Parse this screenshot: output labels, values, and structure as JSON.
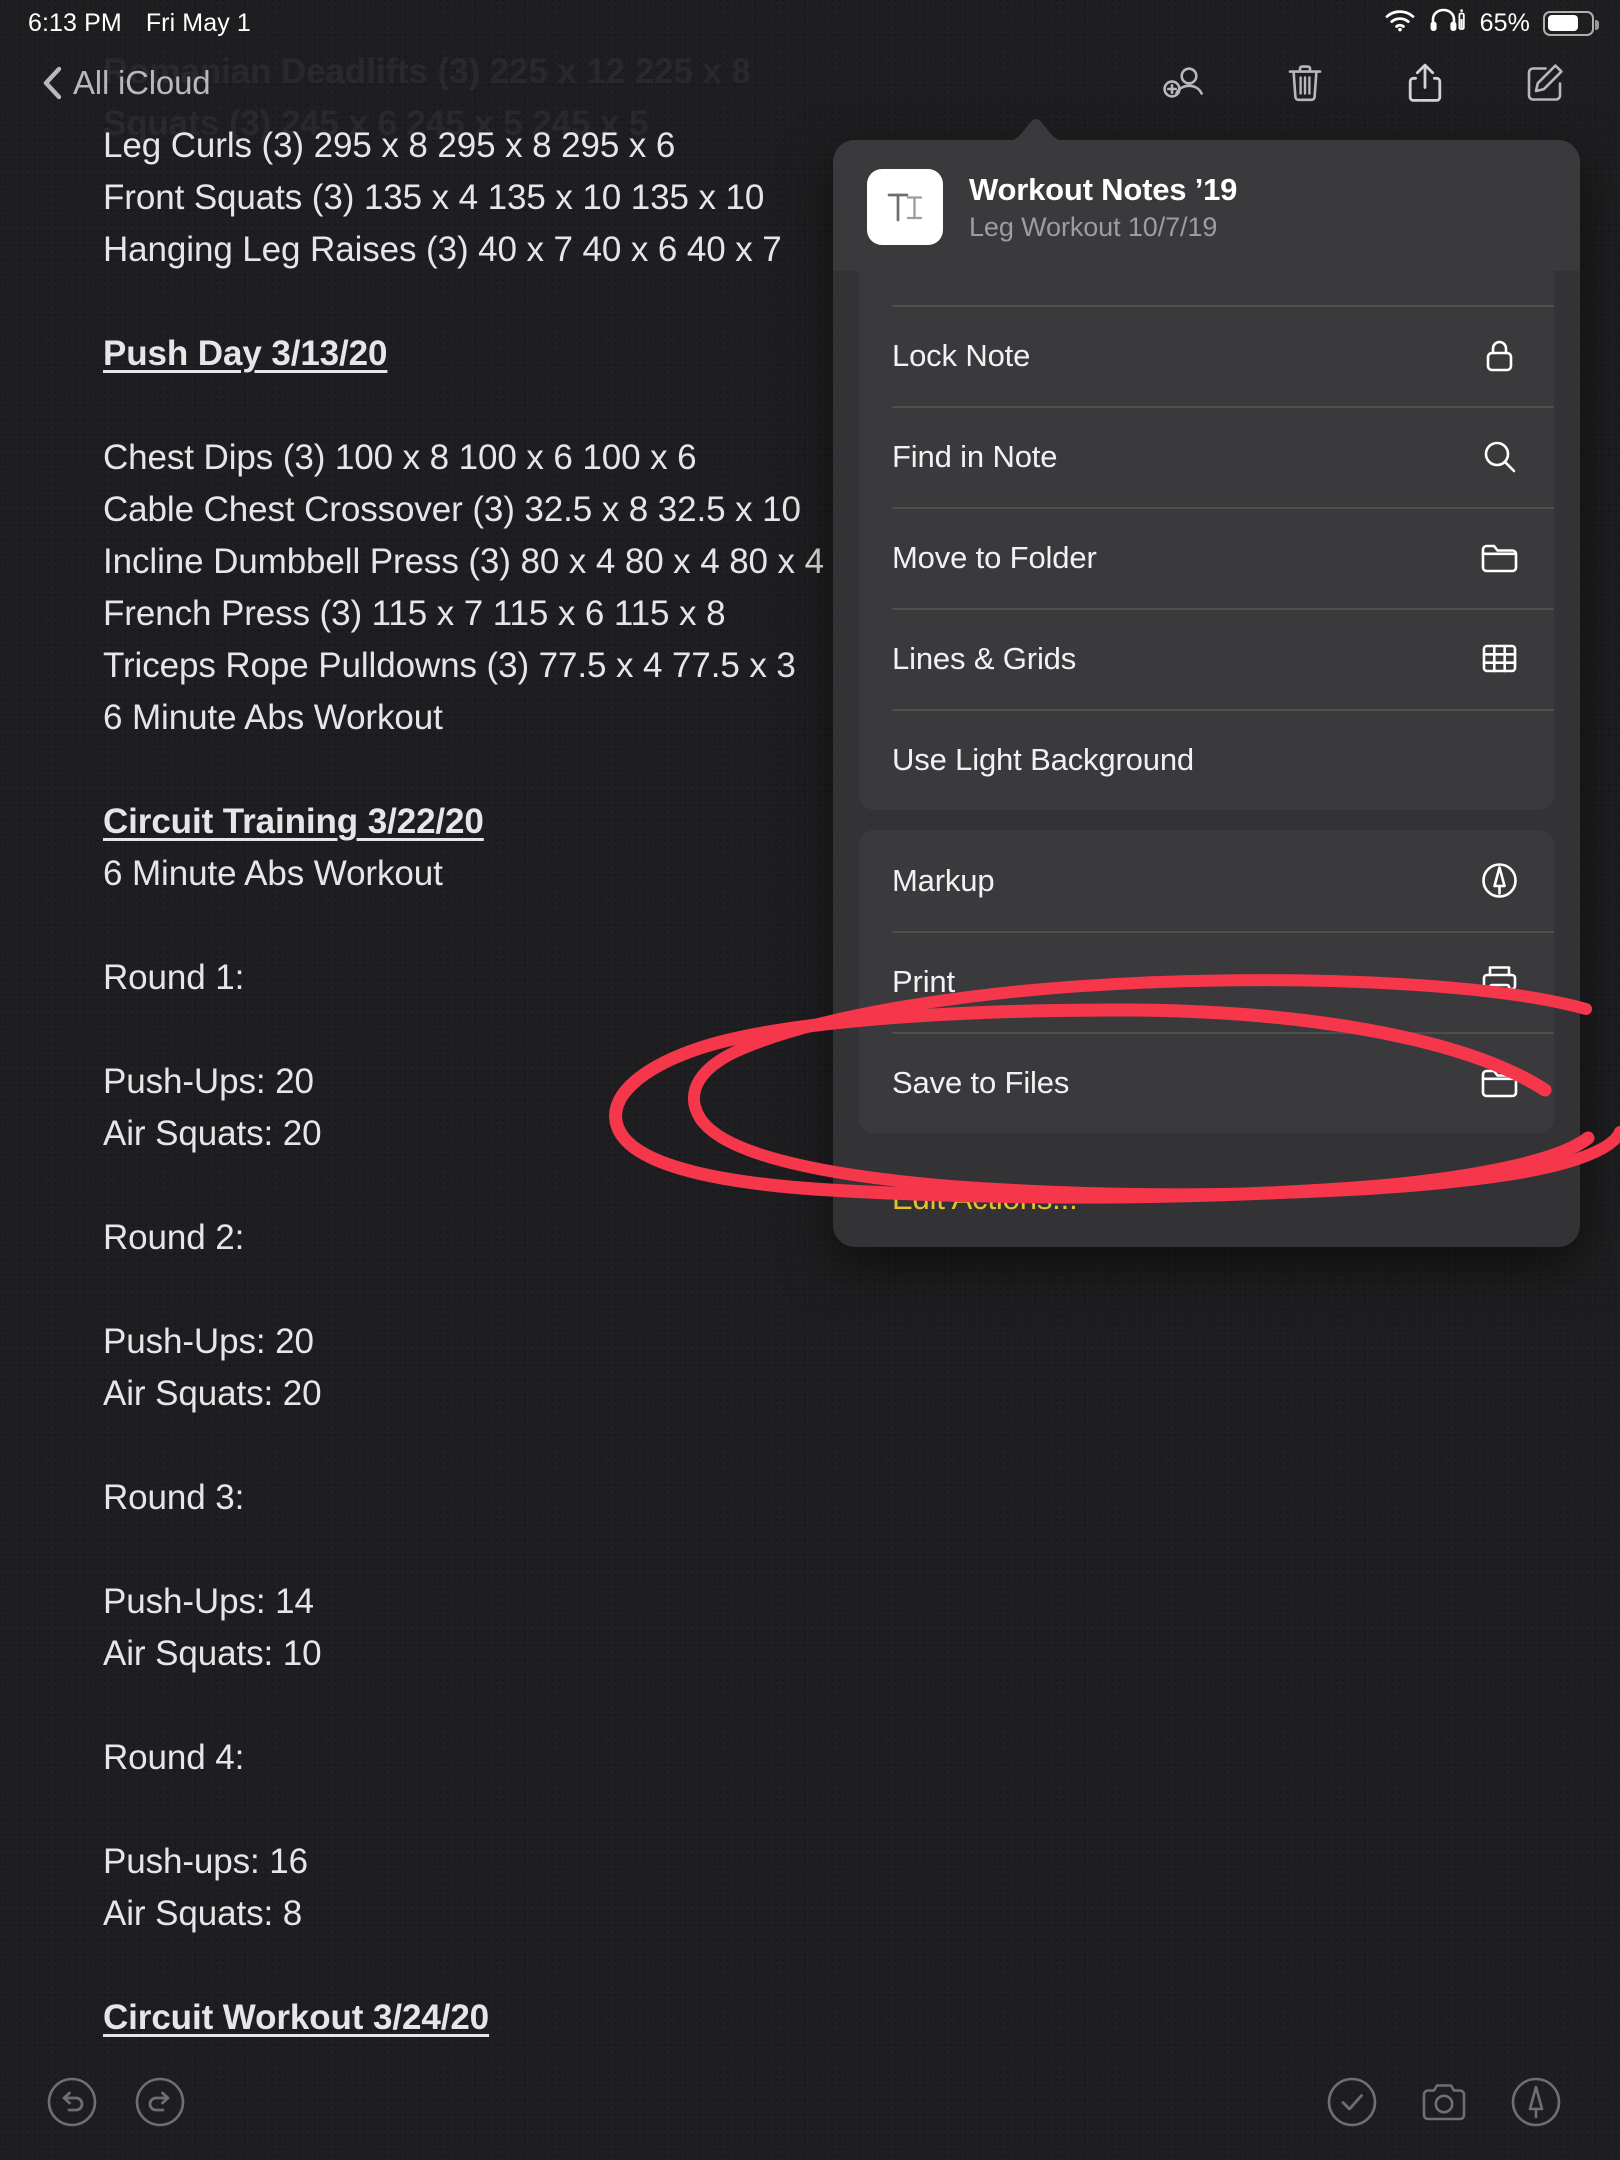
{
  "status_bar": {
    "time": "6:13 PM",
    "date": "Fri May 1",
    "battery_percent": "65%",
    "wifi_icon": "wifi-icon",
    "headphones_icon": "headphones-icon",
    "battery_icon": "battery-icon"
  },
  "nav": {
    "back_label": "All iCloud",
    "back_icon": "chevron-left-icon",
    "toolbar": [
      {
        "name": "add-person-button",
        "icon": "person-add-icon"
      },
      {
        "name": "delete-note-button",
        "icon": "trash-icon"
      },
      {
        "name": "share-button",
        "icon": "share-icon"
      },
      {
        "name": "compose-note-button",
        "icon": "compose-icon"
      }
    ]
  },
  "note": {
    "ghost_lines": [
      "Romanian Deadlifts (3) 225 x 12 225 x 8",
      "Squats (3) 245 x 6 245 x 5 245 x 5"
    ],
    "lines": [
      {
        "text": "Leg Curls (3) 295 x 8 295 x 8 295 x 6",
        "style": "body"
      },
      {
        "text": "Front Squats (3) 135 x 4 135 x 10 135 x 10",
        "style": "body"
      },
      {
        "text": "Hanging Leg Raises (3) 40 x 7 40 x 6 40 x 7",
        "style": "body"
      },
      {
        "text": "",
        "style": "blank"
      },
      {
        "text": "Push Day 3/13/20",
        "style": "heading"
      },
      {
        "text": "",
        "style": "blank"
      },
      {
        "text": "Chest Dips (3) 100 x 8 100 x 6 100 x 6",
        "style": "body"
      },
      {
        "text": "Cable Chest Crossover (3) 32.5 x 8 32.5 x 10",
        "style": "body"
      },
      {
        "text": "Incline Dumbbell Press (3) 80 x 4 80 x 4 80 x 4",
        "style": "body"
      },
      {
        "text": "French Press (3) 115 x 7 115 x 6 115 x 8",
        "style": "body"
      },
      {
        "text": "Triceps Rope Pulldowns (3) 77.5 x 4 77.5 x 3",
        "style": "body"
      },
      {
        "text": "6 Minute Abs Workout",
        "style": "body"
      },
      {
        "text": "",
        "style": "blank"
      },
      {
        "text": "Circuit Training 3/22/20",
        "style": "heading"
      },
      {
        "text": "6 Minute Abs Workout",
        "style": "body"
      },
      {
        "text": "",
        "style": "blank"
      },
      {
        "text": "Round 1:",
        "style": "body"
      },
      {
        "text": "",
        "style": "blank"
      },
      {
        "text": "Push-Ups: 20",
        "style": "body"
      },
      {
        "text": "Air Squats: 20",
        "style": "body"
      },
      {
        "text": "",
        "style": "blank"
      },
      {
        "text": "Round 2:",
        "style": "body"
      },
      {
        "text": "",
        "style": "blank"
      },
      {
        "text": "Push-Ups: 20",
        "style": "body"
      },
      {
        "text": "Air Squats: 20",
        "style": "body"
      },
      {
        "text": "",
        "style": "blank"
      },
      {
        "text": "Round 3:",
        "style": "body"
      },
      {
        "text": "",
        "style": "blank"
      },
      {
        "text": "Push-Ups: 14",
        "style": "body"
      },
      {
        "text": "Air Squats: 10",
        "style": "body"
      },
      {
        "text": "",
        "style": "blank"
      },
      {
        "text": "Round 4:",
        "style": "body"
      },
      {
        "text": "",
        "style": "blank"
      },
      {
        "text": "Push-ups: 16",
        "style": "body"
      },
      {
        "text": "Air Squats: 8",
        "style": "body"
      },
      {
        "text": "",
        "style": "blank"
      },
      {
        "text": "Circuit Workout 3/24/20",
        "style": "heading"
      }
    ]
  },
  "share_popover": {
    "title": "Workout Notes ’19",
    "subtitle": "Leg Workout 10/7/19",
    "thumbnail_icon": "text-style-icon",
    "group_one": [
      {
        "label": "Lock Note",
        "icon": "lock-icon"
      },
      {
        "label": "Find in Note",
        "icon": "search-icon"
      },
      {
        "label": "Move to Folder",
        "icon": "folder-icon"
      },
      {
        "label": "Lines & Grids",
        "icon": "grid-icon"
      },
      {
        "label": "Use Light Background",
        "icon": ""
      }
    ],
    "group_two": [
      {
        "label": "Markup",
        "icon": "markup-pen-icon"
      },
      {
        "label": "Print",
        "icon": "printer-icon"
      },
      {
        "label": "Save to Files",
        "icon": "folder-icon"
      }
    ],
    "edit_actions_label": "Edit Actions...",
    "edit_actions_color": "#e4c02b"
  },
  "annotation": {
    "shape": "hand-drawn-red-ellipse",
    "color": "#f6374b",
    "target_label": "Save to Files"
  },
  "bottom_bar": {
    "left": [
      {
        "name": "undo-button",
        "icon": "undo-icon"
      },
      {
        "name": "redo-button",
        "icon": "redo-icon"
      }
    ],
    "right": [
      {
        "name": "checklist-button",
        "icon": "checkmark-circle-icon"
      },
      {
        "name": "camera-button",
        "icon": "camera-icon"
      },
      {
        "name": "markup-button",
        "icon": "markup-pen-icon"
      }
    ]
  }
}
